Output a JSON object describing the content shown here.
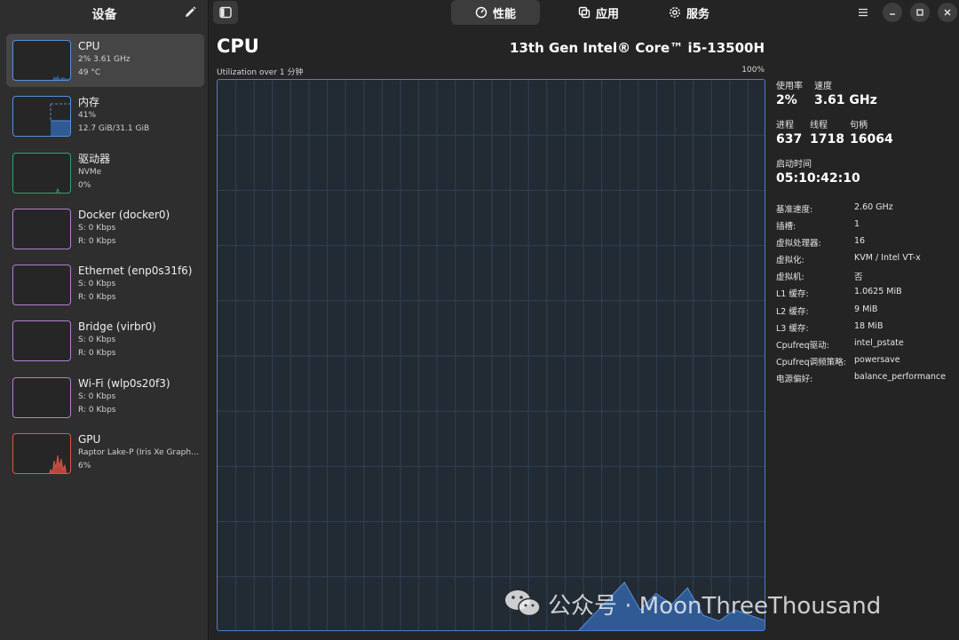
{
  "sidebar": {
    "title": "设备",
    "devices": [
      {
        "name": "CPU",
        "line1": "2% 3.61 GHz",
        "line2": "49 °C",
        "color": "#5a8fd6"
      },
      {
        "name": "内存",
        "line1": "41%",
        "line2": "12.7 GiB/31.1 GiB",
        "color": "#5a8fd6",
        "fill_fraction": 0.41
      },
      {
        "name": "驱动器",
        "line1": "NVMe",
        "line2": "0%",
        "color": "#2fa36b"
      },
      {
        "name": "Docker (docker0)",
        "line1": "S: 0 Kbps",
        "line2": "R: 0 Kbps",
        "color": "#b67fd1"
      },
      {
        "name": "Ethernet (enp0s31f6)",
        "line1": "S: 0 Kbps",
        "line2": "R: 0 Kbps",
        "color": "#b67fd1"
      },
      {
        "name": "Bridge (virbr0)",
        "line1": "S: 0 Kbps",
        "line2": "R: 0 Kbps",
        "color": "#b67fd1"
      },
      {
        "name": "Wi-Fi (wlp0s20f3)",
        "line1": "S: 0 Kbps",
        "line2": "R: 0 Kbps",
        "color": "#b67fd1"
      },
      {
        "name": "GPU",
        "line1": "Raptor Lake-P (Iris Xe Graphics)",
        "line2": "6%",
        "color": "#d65a4a"
      }
    ]
  },
  "header": {
    "tabs": [
      {
        "label": "性能",
        "icon": "gauge-icon",
        "active": true
      },
      {
        "label": "应用",
        "icon": "apps-icon",
        "active": false
      },
      {
        "label": "服务",
        "icon": "gear-icon",
        "active": false
      }
    ]
  },
  "main": {
    "title": "CPU",
    "model": "13th Gen Intel® Core™ i5-13500H",
    "util_label": "Utilization over 1 分钟",
    "util_max": "100%"
  },
  "stats": {
    "usage_label": "使用率",
    "usage_value": "2%",
    "speed_label": "速度",
    "speed_value": "3.61 GHz",
    "processes_label": "进程",
    "processes_value": "637",
    "threads_label": "线程",
    "threads_value": "1718",
    "handles_label": "句柄",
    "handles_value": "16064",
    "uptime_label": "启动时间",
    "uptime_value": "05:10:42:10",
    "specs": [
      {
        "k": "基准速度:",
        "v": "2.60 GHz"
      },
      {
        "k": "插槽:",
        "v": "1"
      },
      {
        "k": "虚拟处理器:",
        "v": "16"
      },
      {
        "k": "虚拟化:",
        "v": "KVM / Intel VT-x"
      },
      {
        "k": "虚拟机:",
        "v": "否"
      },
      {
        "k": "L1 缓存:",
        "v": "1.0625 MiB"
      },
      {
        "k": "L2 缓存:",
        "v": "9 MiB"
      },
      {
        "k": "L3 缓存:",
        "v": "18 MiB"
      },
      {
        "k": "Cpufreq驱动:",
        "v": "intel_pstate"
      },
      {
        "k": "Cpufreq调频策略:",
        "v": "powersave"
      },
      {
        "k": "电源偏好:",
        "v": "balance_performance"
      }
    ]
  },
  "watermark": {
    "text": "公众号 · MoonThreeThousand"
  },
  "colors": {
    "accent": "#5a8fd6",
    "graph_fill": "#2f5a93"
  }
}
